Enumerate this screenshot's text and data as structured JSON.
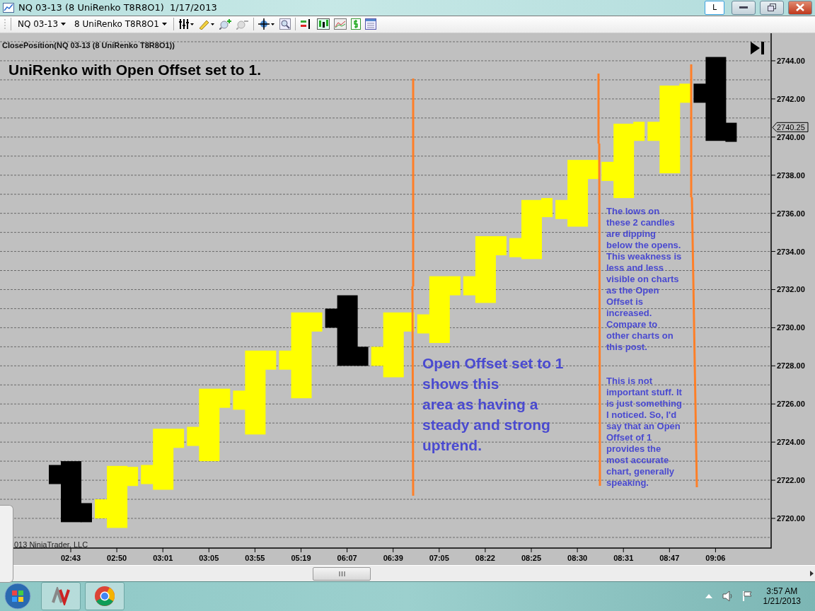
{
  "window": {
    "title": "NQ 03-13 (8 UniRenko T8R8O1)  1/17/2013",
    "badge": "L"
  },
  "toolbar": {
    "instrument": "NQ 03-13",
    "bar_type": "8 UniRenko T8R8O1"
  },
  "chart": {
    "strategy_label": "ClosePosition(NQ 03-13 (8 UniRenko T8R8O1))",
    "title": "UniRenko with Open Offset set to 1.",
    "copyright": "013 NinjaTrader, LLC",
    "price_marker": "2740.25",
    "annotations": [
      {
        "kind": "large",
        "text": "Open Offset set to 1\nshows this\narea as having a\nsteady and strong\nuptrend."
      },
      {
        "kind": "small",
        "text": "The lows on\nthese 2 candles\nare dipping\nbelow the opens.\nThis weakness is\nless and less\nvisible on charts\nas the Open\nOffset is\nincreased.\nCompare to\nother charts on\nthis post."
      },
      {
        "kind": "small",
        "text": "This is not\nimportant stuff. It\nis just something\nI noticed. So, I'd\nsay that an Open\nOffset of 1\nprovides the\nmost accurate\nchart, generally\nspeaking."
      }
    ],
    "price_labels": [
      "2744.00",
      "2742.00",
      "2740.00",
      "2738.00",
      "2736.00",
      "2734.00",
      "2732.00",
      "2730.00",
      "2728.00",
      "2726.00",
      "2724.00",
      "2722.00",
      "2720.00"
    ],
    "time_labels": [
      "02:43",
      "02:50",
      "03:01",
      "03:05",
      "03:55",
      "05:19",
      "06:07",
      "06:39",
      "07:05",
      "08:22",
      "08:25",
      "08:30",
      "08:31",
      "08:47",
      "09:06"
    ]
  },
  "taskbar": {
    "time": "3:57 AM",
    "date": "1/21/2013"
  }
}
